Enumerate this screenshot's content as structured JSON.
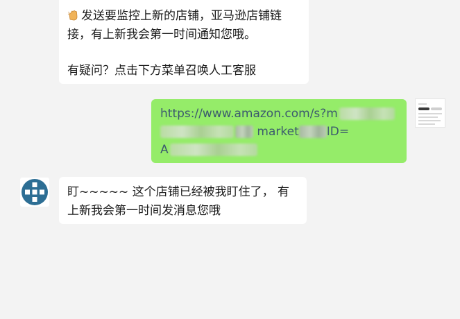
{
  "messages": {
    "incoming_top": {
      "line1": "发送要监控上新的店铺，亚马逊店铺链",
      "line2": "接，有上新我会第一时间通知您哦。",
      "line3": "有疑问？点击下方菜单召唤人工客服",
      "icon": "waving-hand-icon"
    },
    "outgoing_link": {
      "line1": "https://www.amazon.com/s?m",
      "line2_text": "market",
      "line2_suffix": "ID=",
      "line3": "A"
    },
    "incoming_reply": {
      "line1": "盯~~~~~  这个店铺已经被我盯住了， 有",
      "line2": "上新我会第一时间发消息您哦"
    }
  },
  "avatars": {
    "bot": "bot-avatar",
    "self": "user-avatar"
  },
  "colors": {
    "background": "#f3f3f3",
    "incoming_bubble": "#ffffff",
    "outgoing_bubble": "#95ec69",
    "link_text": "#3c5a6e",
    "bot_avatar_blue": "#2d6e94"
  }
}
